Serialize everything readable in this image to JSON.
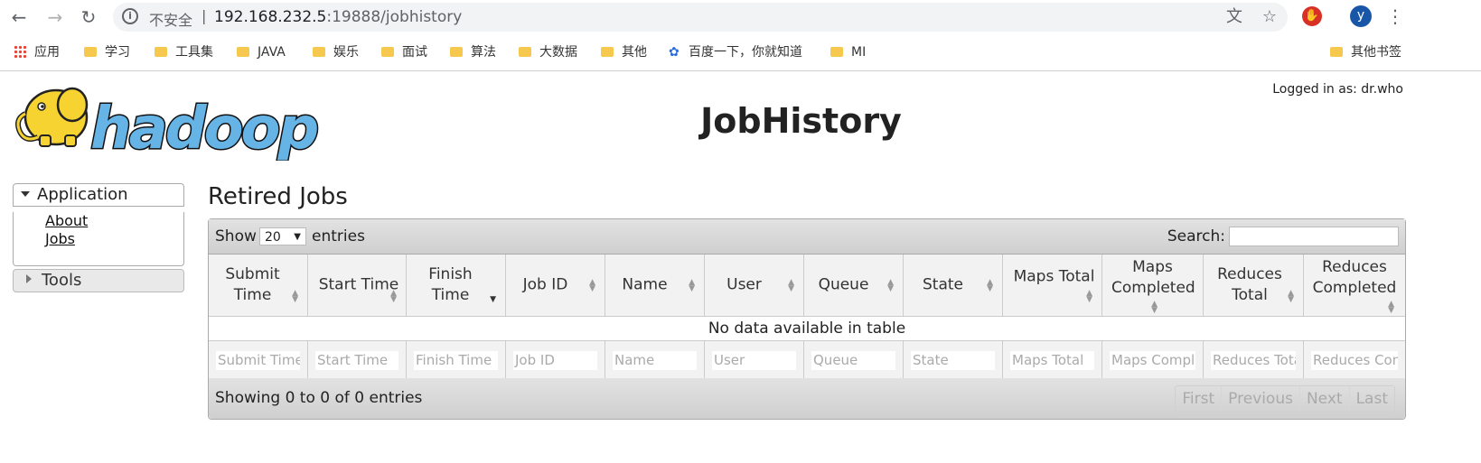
{
  "browser": {
    "security_label": "不安全",
    "separator": "|",
    "url_host": "192.168.232.5",
    "url_rest": ":19888/jobhistory",
    "profile_initial": "y"
  },
  "bookmarks": [
    {
      "label": "应用",
      "icon": "apps-grid-icon"
    },
    {
      "label": "学习",
      "icon": "folder-icon"
    },
    {
      "label": "工具集",
      "icon": "folder-icon"
    },
    {
      "label": "JAVA",
      "icon": "folder-icon"
    },
    {
      "label": "娱乐",
      "icon": "folder-icon"
    },
    {
      "label": "面试",
      "icon": "folder-icon"
    },
    {
      "label": "算法",
      "icon": "folder-icon"
    },
    {
      "label": "大数据",
      "icon": "folder-icon"
    },
    {
      "label": "其他",
      "icon": "folder-icon"
    },
    {
      "label": "百度一下，你就知道",
      "icon": "baidu-paw-icon"
    },
    {
      "label": "MI",
      "icon": "folder-icon"
    },
    {
      "label": "其他书签",
      "icon": "folder-icon"
    }
  ],
  "page": {
    "logo_text": "hadoop",
    "logged_in": "Logged in as: dr.who",
    "title": "JobHistory",
    "section_title": "Retired Jobs"
  },
  "sidebar": {
    "application_label": "Application",
    "links": [
      "About",
      "Jobs"
    ],
    "tools_label": "Tools"
  },
  "table": {
    "show_label": "Show",
    "page_length": "20",
    "entries_label": "entries",
    "search_label": "Search:",
    "columns": [
      "Submit Time",
      "Start Time",
      "Finish Time",
      "Job ID",
      "Name",
      "User",
      "Queue",
      "State",
      "Maps Total",
      "Maps Completed",
      "Reduces Total",
      "Reduces Completed"
    ],
    "filter_placeholders": [
      "Submit Time",
      "Start Time",
      "Finish Time",
      "Job ID",
      "Name",
      "User",
      "Queue",
      "State",
      "Maps Total",
      "Maps Completed",
      "Reduces Total",
      "Reduces Completed"
    ],
    "empty_message": "No data available in table",
    "info": "Showing 0 to 0 of 0 entries",
    "pager": [
      "First",
      "Previous",
      "Next",
      "Last"
    ]
  },
  "colors": {
    "accent_profile": "#1a56a8",
    "logo_yellow": "#f6d330",
    "logo_blue": "#66b3e6"
  }
}
